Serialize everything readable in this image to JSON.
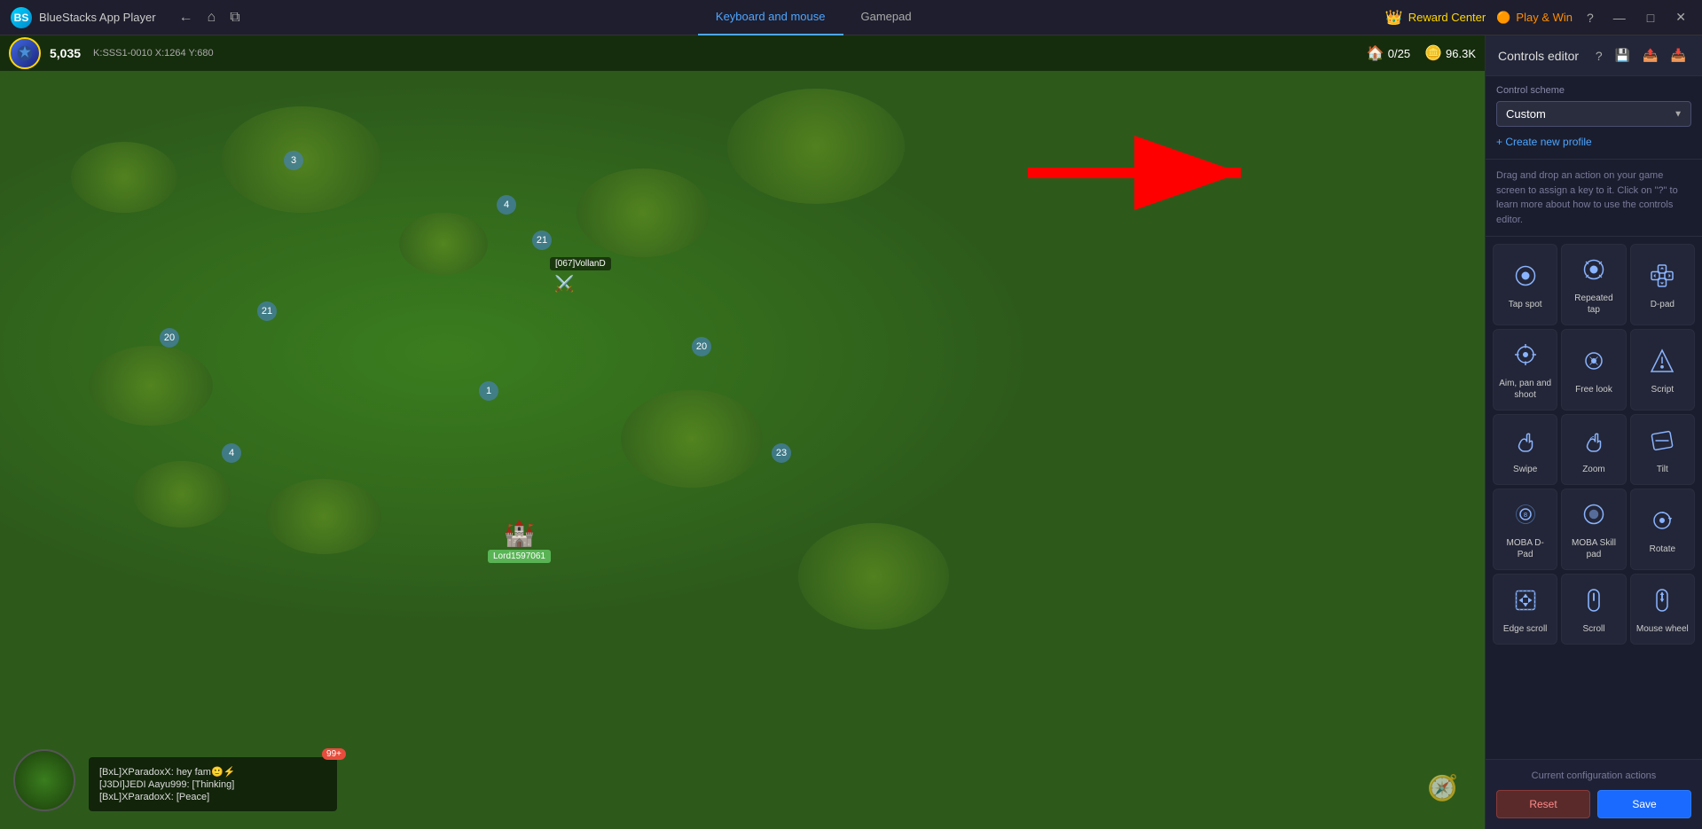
{
  "app": {
    "title": "BlueStacks App Player"
  },
  "topbar": {
    "tabs": [
      {
        "id": "keyboard",
        "label": "Keyboard and mouse",
        "active": true
      },
      {
        "id": "gamepad",
        "label": "Gamepad",
        "active": false
      }
    ],
    "reward_center": "Reward Center",
    "play_win": "Play & Win"
  },
  "game": {
    "player_score": "5,035",
    "coords": "K:SSS1-0010 X:1264 Y:680",
    "resources": [
      {
        "icon": "🏠",
        "value": "0/25"
      },
      {
        "icon": "🪙",
        "value": "96.3K"
      }
    ],
    "chat": [
      {
        "text": "[BxL]XParadoxX: hey fam🙂⚡"
      },
      {
        "text": "[J3DI]JEDI Aayu999: [Thinking]"
      },
      {
        "text": "[BxL]XParadoxX: [Peace]"
      }
    ],
    "chat_badge": "99+"
  },
  "controls_panel": {
    "title": "Controls editor",
    "scheme_label": "Control scheme",
    "scheme_value": "Custom",
    "create_profile_label": "+ Create new profile",
    "help_text": "Drag and drop an action on your game screen to assign a key to it. Click on \"?\" to learn more about how to use the controls editor.",
    "controls": [
      {
        "id": "tap_spot",
        "label": "Tap spot"
      },
      {
        "id": "repeated_tap",
        "label": "Repeated tap"
      },
      {
        "id": "d_pad",
        "label": "D-pad"
      },
      {
        "id": "aim_pan",
        "label": "Aim, pan and shoot"
      },
      {
        "id": "free_look",
        "label": "Free look"
      },
      {
        "id": "script",
        "label": "Script"
      },
      {
        "id": "swipe",
        "label": "Swipe"
      },
      {
        "id": "zoom",
        "label": "Zoom"
      },
      {
        "id": "tilt",
        "label": "Tilt"
      },
      {
        "id": "moba_dpad",
        "label": "MOBA D-Pad"
      },
      {
        "id": "moba_skill",
        "label": "MOBA Skill pad"
      },
      {
        "id": "rotate",
        "label": "Rotate"
      },
      {
        "id": "edge_scroll",
        "label": "Edge scroll"
      },
      {
        "id": "scroll",
        "label": "Scroll"
      },
      {
        "id": "mouse_wheel",
        "label": "Mouse wheel"
      }
    ],
    "config_actions_label": "Current configuration actions",
    "reset_label": "Reset",
    "save_label": "Save"
  }
}
